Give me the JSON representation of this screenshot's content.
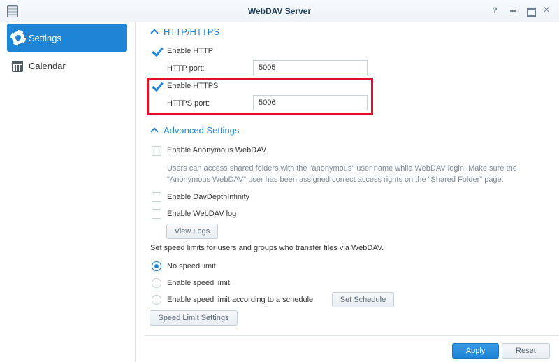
{
  "window": {
    "title": "WebDAV Server",
    "help_glyph": "?",
    "close_glyph": "×"
  },
  "sidebar": {
    "items": [
      {
        "label": "Settings",
        "icon": "gear-icon",
        "active": true
      },
      {
        "label": "Calendar",
        "icon": "calendar-icon",
        "active": false
      }
    ]
  },
  "http_section": {
    "title": "HTTP/HTTPS",
    "enable_http": {
      "label": "Enable HTTP",
      "checked": true
    },
    "http_port": {
      "label": "HTTP port:",
      "value": "5005"
    },
    "enable_https": {
      "label": "Enable HTTPS",
      "checked": true
    },
    "https_port": {
      "label": "HTTPS port:",
      "value": "5006"
    }
  },
  "advanced_section": {
    "title": "Advanced Settings",
    "anonymous": {
      "label": "Enable Anonymous WebDAV",
      "checked": false
    },
    "anonymous_desc": "Users can access shared folders with the \"anonymous\" user name while WebDAV login. Make sure the \"Anonymous WebDAV\" user has been assigned correct access rights on the \"Shared Folder\" page.",
    "depth_infinity": {
      "label": "Enable DavDepthInfinity",
      "checked": false
    },
    "webdav_log": {
      "label": "Enable WebDAV log",
      "checked": false
    },
    "view_logs_label": "View Logs",
    "speed_intro": "Set speed limits for users and groups who transfer files via WebDAV.",
    "speed_options": [
      {
        "label": "No speed limit",
        "selected": true
      },
      {
        "label": "Enable speed limit",
        "selected": false
      },
      {
        "label": "Enable speed limit according to a schedule",
        "selected": false
      }
    ],
    "set_schedule_label": "Set Schedule",
    "speed_limit_settings_label": "Speed Limit Settings"
  },
  "footer": {
    "apply_label": "Apply",
    "reset_label": "Reset"
  },
  "colors": {
    "accent": "#1e84d6",
    "highlight": "#e0102b"
  }
}
